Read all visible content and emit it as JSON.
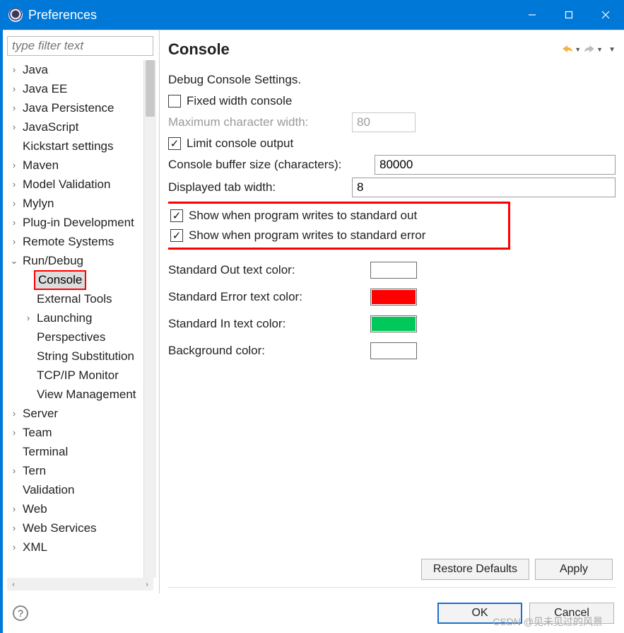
{
  "window": {
    "title": "Preferences"
  },
  "filter": {
    "placeholder": "type filter text"
  },
  "tree": {
    "items": [
      {
        "label": "Java",
        "depth": 0,
        "expandable": true
      },
      {
        "label": "Java EE",
        "depth": 0,
        "expandable": true
      },
      {
        "label": "Java Persistence",
        "depth": 0,
        "expandable": true
      },
      {
        "label": "JavaScript",
        "depth": 0,
        "expandable": true
      },
      {
        "label": "Kickstart settings",
        "depth": 0,
        "expandable": false
      },
      {
        "label": "Maven",
        "depth": 0,
        "expandable": true
      },
      {
        "label": "Model Validation",
        "depth": 0,
        "expandable": true
      },
      {
        "label": "Mylyn",
        "depth": 0,
        "expandable": true
      },
      {
        "label": "Plug-in Development",
        "depth": 0,
        "expandable": true
      },
      {
        "label": "Remote Systems",
        "depth": 0,
        "expandable": true
      },
      {
        "label": "Run/Debug",
        "depth": 0,
        "expandable": true,
        "expanded": true
      },
      {
        "label": "Console",
        "depth": 1,
        "expandable": false,
        "selected": true,
        "outlined": true
      },
      {
        "label": "External Tools",
        "depth": 1,
        "expandable": false
      },
      {
        "label": "Launching",
        "depth": 1,
        "expandable": true
      },
      {
        "label": "Perspectives",
        "depth": 1,
        "expandable": false
      },
      {
        "label": "String Substitution",
        "depth": 1,
        "expandable": false
      },
      {
        "label": "TCP/IP Monitor",
        "depth": 1,
        "expandable": false
      },
      {
        "label": "View Management",
        "depth": 1,
        "expandable": false
      },
      {
        "label": "Server",
        "depth": 0,
        "expandable": true
      },
      {
        "label": "Team",
        "depth": 0,
        "expandable": true
      },
      {
        "label": "Terminal",
        "depth": 0,
        "expandable": false
      },
      {
        "label": "Tern",
        "depth": 0,
        "expandable": true
      },
      {
        "label": "Validation",
        "depth": 0,
        "expandable": false
      },
      {
        "label": "Web",
        "depth": 0,
        "expandable": true
      },
      {
        "label": "Web Services",
        "depth": 0,
        "expandable": true
      },
      {
        "label": "XML",
        "depth": 0,
        "expandable": true
      }
    ]
  },
  "section": {
    "title": "Console"
  },
  "settings": {
    "heading": "Debug Console Settings.",
    "fixed_width_label": "Fixed width console",
    "fixed_width_checked": false,
    "max_char_width_label": "Maximum character width:",
    "max_char_width_value": "80",
    "limit_output_label": "Limit console output",
    "limit_output_checked": true,
    "buffer_size_label": "Console buffer size (characters):",
    "buffer_size_value": "80000",
    "tab_width_label": "Displayed tab width:",
    "tab_width_value": "8",
    "show_stdout_label": "Show when program writes to standard out",
    "show_stdout_checked": true,
    "show_stderr_label": "Show when program writes to standard error",
    "show_stderr_checked": true,
    "stdout_color_label": "Standard Out text color:",
    "stderr_color_label": "Standard Error text color:",
    "stdin_color_label": "Standard In text color:",
    "bg_color_label": "Background color:",
    "colors": {
      "stdout": "#000000",
      "stderr": "#ff0000",
      "stdin": "#00c85a",
      "background": "#ffffff"
    }
  },
  "buttons": {
    "restore_defaults": "Restore Defaults",
    "apply": "Apply",
    "ok": "OK",
    "cancel": "Cancel"
  },
  "watermark": "CSDN @见未见过的风景"
}
